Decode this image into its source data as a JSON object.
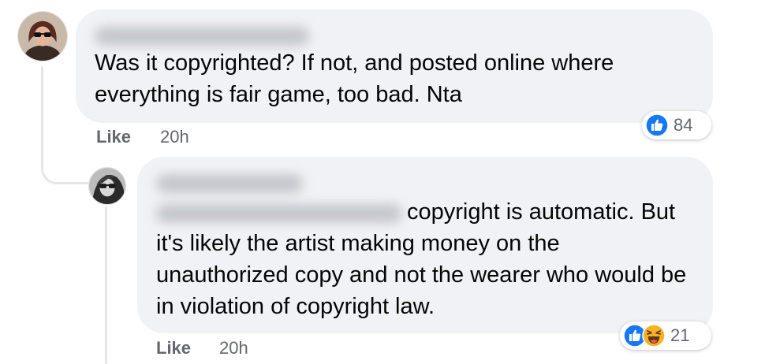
{
  "colors": {
    "bubble_bg": "#f0f2f5",
    "like_blue": "#1877f2",
    "haha_yellow": "#f7b125",
    "meta_text": "#65676b"
  },
  "comments": [
    {
      "author": "",
      "text": "Was it copyrighted? If not, and posted online where everything is fair game, too bad. Nta",
      "like_label": "Like",
      "time": "20h",
      "reactions": {
        "icons": [
          "like-icon"
        ],
        "count": "84"
      }
    },
    {
      "author": "",
      "mention": "",
      "text": "copyright is automatic. But it's likely the artist making money on the unauthorized copy and not the wearer who would be in violation of copyright law.",
      "like_label": "Like",
      "time": "20h",
      "reactions": {
        "icons": [
          "like-icon",
          "haha-icon"
        ],
        "count": "21"
      }
    }
  ]
}
